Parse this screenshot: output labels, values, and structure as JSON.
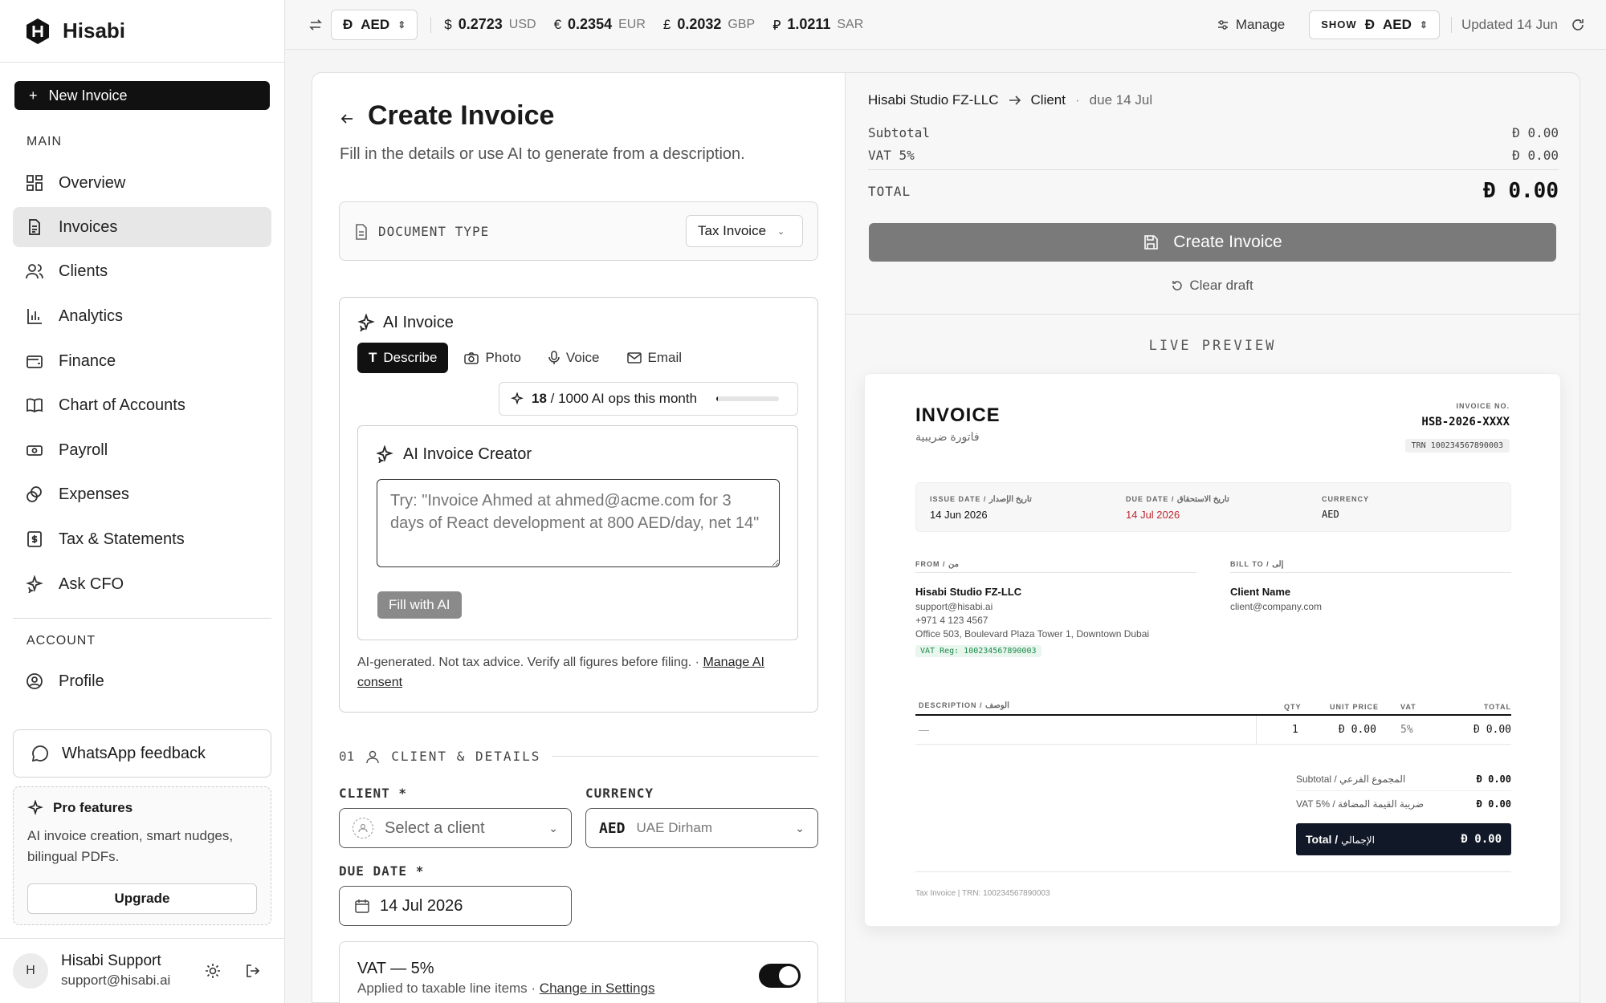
{
  "app": {
    "name": "Hisabi"
  },
  "sidebar": {
    "new_invoice": "New Invoice",
    "section_main": "MAIN",
    "items": [
      {
        "label": "Overview",
        "icon": "grid-icon"
      },
      {
        "label": "Invoices",
        "icon": "document-icon",
        "active": true
      },
      {
        "label": "Clients",
        "icon": "users-icon"
      },
      {
        "label": "Analytics",
        "icon": "bar-chart-icon"
      },
      {
        "label": "Finance",
        "icon": "wallet-icon"
      },
      {
        "label": "Chart of Accounts",
        "icon": "book-icon"
      },
      {
        "label": "Payroll",
        "icon": "banknote-icon"
      },
      {
        "label": "Expenses",
        "icon": "coins-icon"
      },
      {
        "label": "Tax & Statements",
        "icon": "receipt-icon"
      },
      {
        "label": "Ask CFO",
        "icon": "sparkles-icon"
      }
    ],
    "section_account": "ACCOUNT",
    "profile": "Profile",
    "whatsapp": "WhatsApp feedback",
    "pro": {
      "title": "Pro features",
      "desc": "AI invoice creation, smart nudges, bilingual PDFs.",
      "upgrade": "Upgrade"
    },
    "user": {
      "initial": "H",
      "name": "Hisabi Support",
      "email": "support@hisabi.ai"
    }
  },
  "topbar": {
    "base_currency": "AED",
    "rates": [
      {
        "symbol": "$",
        "value": "0.2723",
        "code": "USD"
      },
      {
        "symbol": "€",
        "value": "0.2354",
        "code": "EUR"
      },
      {
        "symbol": "£",
        "value": "0.2032",
        "code": "GBP"
      },
      {
        "symbol": "⃁",
        "value": "1.0211",
        "code": "SAR"
      }
    ],
    "manage": "Manage",
    "show_label": "SHOW",
    "show_currency": "AED",
    "updated": "Updated 14 Jun"
  },
  "form": {
    "title": "Create Invoice",
    "subtitle": "Fill in the details or use AI to generate from a description.",
    "doc_type_label": "DOCUMENT TYPE",
    "doc_type_value": "Tax Invoice",
    "ai": {
      "title": "AI Invoice",
      "tabs": [
        "Describe",
        "Photo",
        "Voice",
        "Email"
      ],
      "ops_used": "18",
      "ops_rest": "/ 1000 AI ops this month",
      "ops_fraction": 0.018,
      "creator_title": "AI Invoice Creator",
      "placeholder": "Try: \"Invoice Ahmed at ahmed@acme.com for 3 days of React development at 800 AED/day, net 14\"",
      "fill_button": "Fill with AI",
      "disclaimer": "AI-generated. Not tax advice. Verify all figures before filing. · ",
      "consent_link": "Manage AI consent"
    },
    "section_num": "01",
    "section_title": "CLIENT & DETAILS",
    "client_label": "CLIENT *",
    "client_placeholder": "Select a client",
    "currency_label": "CURRENCY",
    "currency_code": "AED",
    "currency_name": "UAE Dirham",
    "due_label": "DUE DATE *",
    "due_value": "14 Jul 2026",
    "vat_title": "VAT — 5%",
    "vat_desc": "Applied to taxable line items · ",
    "vat_link": "Change in Settings",
    "vat_enabled": true
  },
  "summary": {
    "from": "Hisabi Studio FZ-LLC",
    "to": "Client",
    "due": "due 14 Jul",
    "subtotal_label": "Subtotal",
    "subtotal": "0.00",
    "vat_label": "VAT 5%",
    "vat": "0.00",
    "total_label": "TOTAL",
    "total": "0.00",
    "create_button": "Create Invoice",
    "clear": "Clear draft"
  },
  "preview": {
    "heading": "LIVE PREVIEW",
    "title": "INVOICE",
    "title_ar": "فاتورة ضريبية",
    "no_label": "INVOICE NO.",
    "no_value": "HSB-2026-XXXX",
    "trn": "TRN 100234567890003",
    "issue_label": "ISSUE DATE /",
    "issue_label_ar": "تاريخ الإصدار",
    "issue_value": "14 Jun 2026",
    "due_label": "DUE DATE /",
    "due_label_ar": "تاريخ الاستحقاق",
    "due_value": "14 Jul 2026",
    "currency_label": "CURRENCY",
    "currency_value": "AED",
    "from_label": "FROM /",
    "from_label_ar": "من",
    "from_name": "Hisabi Studio FZ-LLC",
    "from_email": "support@hisabi.ai",
    "from_phone": "+971 4 123 4567",
    "from_address": "Office 503, Boulevard Plaza Tower 1, Downtown Dubai",
    "vat_reg": "VAT Reg: 100234567890003",
    "bill_label": "BILL TO /",
    "bill_label_ar": "إلى",
    "bill_name": "Client Name",
    "bill_email": "client@company.com",
    "cols": {
      "desc": "DESCRIPTION /",
      "desc_ar": "الوصف",
      "qty": "QTY",
      "unit": "UNIT PRICE",
      "vat": "VAT",
      "total": "TOTAL"
    },
    "row": {
      "desc": "—",
      "qty": "1",
      "unit": "0.00",
      "vat": "5%",
      "total": "0.00"
    },
    "subtotal_label": "Subtotal / المجموع الفرعي",
    "subtotal": "0.00",
    "vat_label": "VAT 5% / ضريبة القيمة المضافة",
    "vat": "0.00",
    "total_label": "Total /",
    "total_label_ar": "الإجمالي",
    "total": "0.00",
    "footer": "Tax Invoice | TRN: 100234567890003"
  },
  "colors": {
    "accent": "#111111",
    "due_red": "#c0262d",
    "vat_green": "#1c8a4a",
    "disabled_gray": "#7a7a7a"
  }
}
